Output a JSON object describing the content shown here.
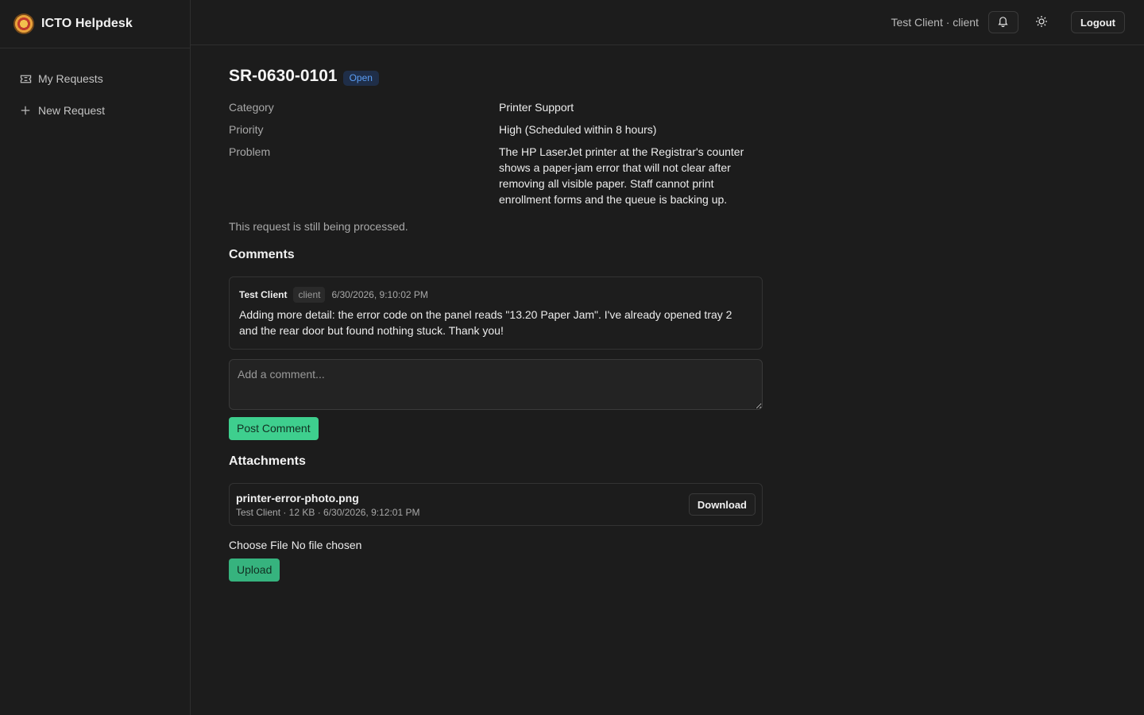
{
  "app": {
    "name": "ICTO Helpdesk",
    "logo_icon": "university-seal-logo"
  },
  "sidebar": {
    "items": [
      {
        "label": "My Requests",
        "icon": "ticket-icon"
      },
      {
        "label": "New Request",
        "icon": "plus-icon"
      }
    ]
  },
  "topbar": {
    "user_label": "Test Client · client",
    "notification_icon": "bell-icon",
    "theme_icon": "sun-icon",
    "logout_label": "Logout"
  },
  "request": {
    "id": "SR-0630-0101",
    "status": "Open",
    "details": [
      {
        "label": "Category",
        "value": "Printer Support"
      },
      {
        "label": "Priority",
        "value": "High (Scheduled within 8 hours)"
      },
      {
        "label": "Problem",
        "value": "The HP LaserJet printer at the Registrar's counter shows a paper-jam error that will not clear after removing all visible paper. Staff cannot print enrollment forms and the queue is backing up."
      }
    ],
    "processing_note": "This request is still being processed."
  },
  "comments": {
    "title": "Comments",
    "items": [
      {
        "author": "Test Client",
        "role": "client",
        "time": "6/30/2026, 9:10:02 PM",
        "body": "Adding more detail: the error code on the panel reads \"13.20 Paper Jam\". I've already opened tray 2 and the rear door but found nothing stuck. Thank you!"
      }
    ],
    "input_placeholder": "Add a comment...",
    "post_label": "Post Comment"
  },
  "attachments": {
    "title": "Attachments",
    "items": [
      {
        "name": "printer-error-photo.png",
        "meta": "Test Client · 12 KB · 6/30/2026, 9:12:01 PM",
        "download_label": "Download"
      }
    ],
    "choose_label": "Choose File",
    "no_file_label": "No file chosen",
    "upload_label": "Upload"
  },
  "colors": {
    "background": "#1c1c1c",
    "accent_green": "#3ecf8e",
    "status_blue": "#5b9ef5"
  }
}
